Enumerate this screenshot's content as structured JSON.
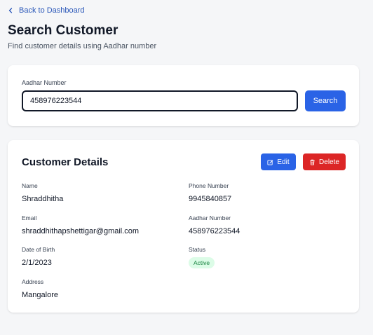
{
  "nav": {
    "back_label": "Back to Dashboard"
  },
  "header": {
    "title": "Search Customer",
    "subtitle": "Find customer details using Aadhar number"
  },
  "search": {
    "label": "Aadhar Number",
    "value": "458976223544",
    "button_label": "Search"
  },
  "details": {
    "title": "Customer Details",
    "edit_label": "Edit",
    "delete_label": "Delete",
    "name_label": "Name",
    "name": "Shraddhitha",
    "phone_label": "Phone Number",
    "phone": "9945840857",
    "email_label": "Email",
    "email": "shraddhithapshettigar@gmail.com",
    "aadhar_label": "Aadhar Number",
    "aadhar": "458976223544",
    "dob_label": "Date of Birth",
    "dob": "2/1/2023",
    "status_label": "Status",
    "status": "Active",
    "address_label": "Address",
    "address": "Mangalore"
  },
  "colors": {
    "primary": "#2a63e6",
    "danger": "#dc2626",
    "success_bg": "#dcfce7",
    "success_text": "#15803d"
  },
  "icons": {
    "back": "chevron-left-icon",
    "edit": "edit-icon",
    "delete": "trash-icon"
  }
}
